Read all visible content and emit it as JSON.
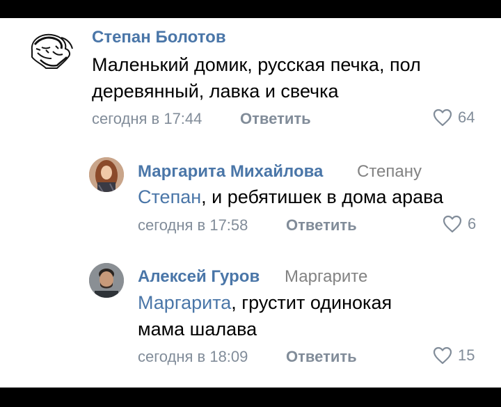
{
  "comments": [
    {
      "author": "Степан Болотов",
      "reply_to": "",
      "mention": "",
      "text_line1": "Маленький домик, русская печка, пол",
      "text_line2": "деревянный, лавка и свечка",
      "time": "сегодня в 17:44",
      "reply_label": "Ответить",
      "likes": "64"
    },
    {
      "author": "Маргарита Михайлова",
      "reply_to": "Степану",
      "mention": "Степан",
      "text_line1": ", и ребятишек в дома арава",
      "text_line2": "",
      "time": "сегодня в 17:58",
      "reply_label": "Ответить",
      "likes": "6"
    },
    {
      "author": "Алексей Гуров",
      "reply_to": "Маргарите",
      "mention": "Маргарита",
      "text_line1": ", грустит одинокая",
      "text_line2": "мама шалава",
      "time": "сегодня в 18:09",
      "reply_label": "Ответить",
      "likes": "15"
    }
  ],
  "colors": {
    "link": "#4a76a8",
    "meta": "#818c99",
    "text": "#000000",
    "background": "#ffffff"
  },
  "icons": {
    "like": "heart-outline-icon"
  }
}
